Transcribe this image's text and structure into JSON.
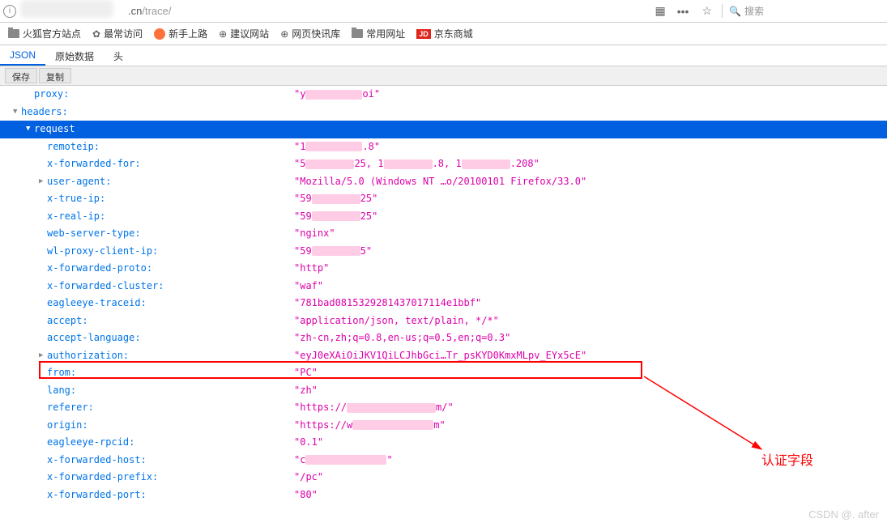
{
  "url": {
    "domain_suffix": ".cn",
    "path": "/trace/"
  },
  "search_placeholder": "搜索",
  "bookmarks": [
    {
      "label": "火狐官方站点",
      "icon": "folder"
    },
    {
      "label": "最常访问",
      "icon": "gear"
    },
    {
      "label": "新手上路",
      "icon": "firefox"
    },
    {
      "label": "建议网站",
      "icon": "globe"
    },
    {
      "label": "网页快讯库",
      "icon": "globe"
    },
    {
      "label": "常用网址",
      "icon": "folder"
    },
    {
      "label": "京东商城",
      "icon": "jd"
    }
  ],
  "tabs": [
    {
      "label": "JSON",
      "active": true
    },
    {
      "label": "原始数据",
      "active": false
    },
    {
      "label": "头",
      "active": false
    }
  ],
  "actions": {
    "save": "保存",
    "copy": "复制"
  },
  "json": {
    "proxy": {
      "key": "proxy",
      "prefix": "\"y",
      "suffix": "oi\"",
      "redact_w": 70
    },
    "headers": {
      "key": "headers"
    },
    "request": {
      "key": "request",
      "selected": true
    },
    "rows": [
      {
        "key": "remoteip",
        "prefix": "\"1",
        "suffix": ".8\"",
        "redact_w": 70
      },
      {
        "key": "x-forwarded-for",
        "prefix": "\"5",
        "mid1": "25, 1",
        "mid2": ".8, 1",
        "suffix": ".208\"",
        "redact_w": 60
      },
      {
        "key": "user-agent",
        "val": "\"Mozilla/5.0 (Windows NT …o/20100101 Firefox/33.0\"",
        "expandable": true
      },
      {
        "key": "x-true-ip",
        "prefix": "\"59",
        "suffix": "25\"",
        "redact_w": 60
      },
      {
        "key": "x-real-ip",
        "prefix": "\"59",
        "suffix": "25\"",
        "redact_w": 60
      },
      {
        "key": "web-server-type",
        "val": "\"nginx\""
      },
      {
        "key": "wl-proxy-client-ip",
        "prefix": "\"59",
        "suffix": "5\"",
        "redact_w": 60
      },
      {
        "key": "x-forwarded-proto",
        "val": "\"http\""
      },
      {
        "key": "x-forwarded-cluster",
        "val": "\"waf\""
      },
      {
        "key": "eagleeye-traceid",
        "val": "\"781bad0815329281437017114e1bbf\""
      },
      {
        "key": "accept",
        "val": "\"application/json, text/plain, */*\""
      },
      {
        "key": "accept-language",
        "val": "\"zh-cn,zh;q=0.8,en-us;q=0.5,en;q=0.3\""
      },
      {
        "key": "authorization",
        "val": "\"eyJ0eXAiOiJKV1QiLCJhbGci…Tr_psKYD0KmxMLpv_EYx5cE\"",
        "expandable": true
      },
      {
        "key": "from",
        "val": "\"PC\""
      },
      {
        "key": "lang",
        "val": "\"zh\""
      },
      {
        "key": "referer",
        "prefix": "\"https://",
        "suffix": "m/\"",
        "redact_w": 110
      },
      {
        "key": "origin",
        "prefix": "\"https://w",
        "suffix": "m\"",
        "redact_w": 100
      },
      {
        "key": "eagleeye-rpcid",
        "val": "\"0.1\""
      },
      {
        "key": "x-forwarded-host",
        "prefix": "\"c",
        "suffix": "\"",
        "redact_w": 100
      },
      {
        "key": "x-forwarded-prefix",
        "val": "\"/pc\""
      },
      {
        "key": "x-forwarded-port",
        "val": "\"80\""
      }
    ]
  },
  "annotation": {
    "label": "认证字段"
  },
  "watermark": "CSDN @. after"
}
